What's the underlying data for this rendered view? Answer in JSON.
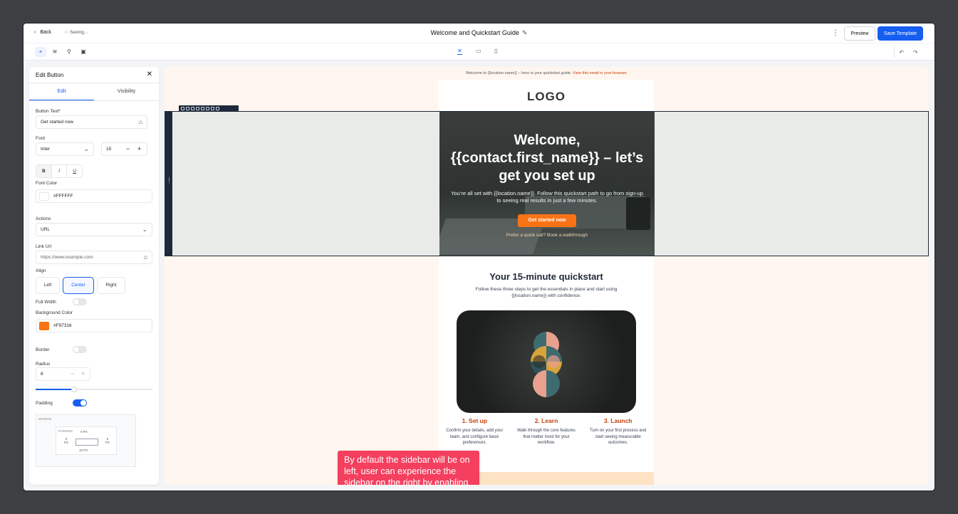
{
  "header": {
    "back_label": "Back",
    "saving_label": "Saving...",
    "title": "Welcome and Quickstart Guide",
    "preview_label": "Preview",
    "save_label": "Save Template"
  },
  "toolbar": {
    "left_tools": [
      "plus-icon",
      "layers-icon",
      "paint-icon",
      "template-icon"
    ],
    "devices": [
      "tools-icon",
      "desktop-icon",
      "mobile-icon"
    ]
  },
  "sidebar": {
    "title": "Edit Button",
    "tabs": [
      "Edit",
      "Visibility"
    ],
    "button_text_label": "Button Text*",
    "button_text_value": "Get started now",
    "font_label": "Font",
    "font_value": "Inter",
    "font_size": "15",
    "format_buttons": [
      "B",
      "I",
      "U"
    ],
    "font_color_label": "Font Color",
    "font_color_value": "#FFFFFF",
    "actions_label": "Actions",
    "actions_value": "URL",
    "link_url_label": "Link Url",
    "link_url_placeholder": "https://www.example.com",
    "align_label": "Align",
    "align_options": [
      "Left",
      "Center",
      "Right"
    ],
    "align_selected": "Center",
    "full_width_label": "Full Width",
    "full_width_on": false,
    "background_color_label": "Background Color",
    "background_color_value": "#F97316",
    "border_label": "Border",
    "border_on": false,
    "radius_label": "Radius",
    "radius_value": "8",
    "radius_slider_fraction": 0.33,
    "padding_label": "Padding",
    "padding_on": true,
    "margin_label": "MARGIN",
    "padding_box_label": "PADDING",
    "padding_top": "0 PX",
    "padding_left": "0\nPX",
    "padding_right": "0\nPX",
    "padding_bottom": "10 PX"
  },
  "email": {
    "preheader_text": "Welcome to {{location.name}} – here is your quickstart guide. ",
    "preheader_link": "View this email in your browser.",
    "logo_text": "LOGO",
    "hero_heading": "Welcome, {{contact.first_name}} – let’s get you set up",
    "hero_body": "You’re all set with {{location.name}}. Follow this quickstart path to go from sign-up to seeing real results in just a few minutes.",
    "hero_cta": "Get started now",
    "hero_alt_link": "Prefer a quick call? Book a walkthrough",
    "section_title": "Your 15-minute quickstart",
    "section_subtitle": "Follow these three steps to get the essentials in place and start using {{location.name}} with confidence.",
    "steps": [
      {
        "title": "1. Set up",
        "text": "Confirm your details, add your team, and configure basic preferences."
      },
      {
        "title": "2. Learn",
        "text": "Walk through the core features that matter most for your workflow."
      },
      {
        "title": "3. Launch",
        "text": "Turn on your first process and start seeing measurable outcomes."
      }
    ]
  },
  "note": {
    "text": "By default the sidebar will be on left, user can experience the sidebar on the right by enabling Email AI in Labs"
  },
  "colors": {
    "accent": "#155eef",
    "cta": "#f97316",
    "note_bg": "#f43f5e",
    "canvas_bg": "#fff7ef"
  }
}
